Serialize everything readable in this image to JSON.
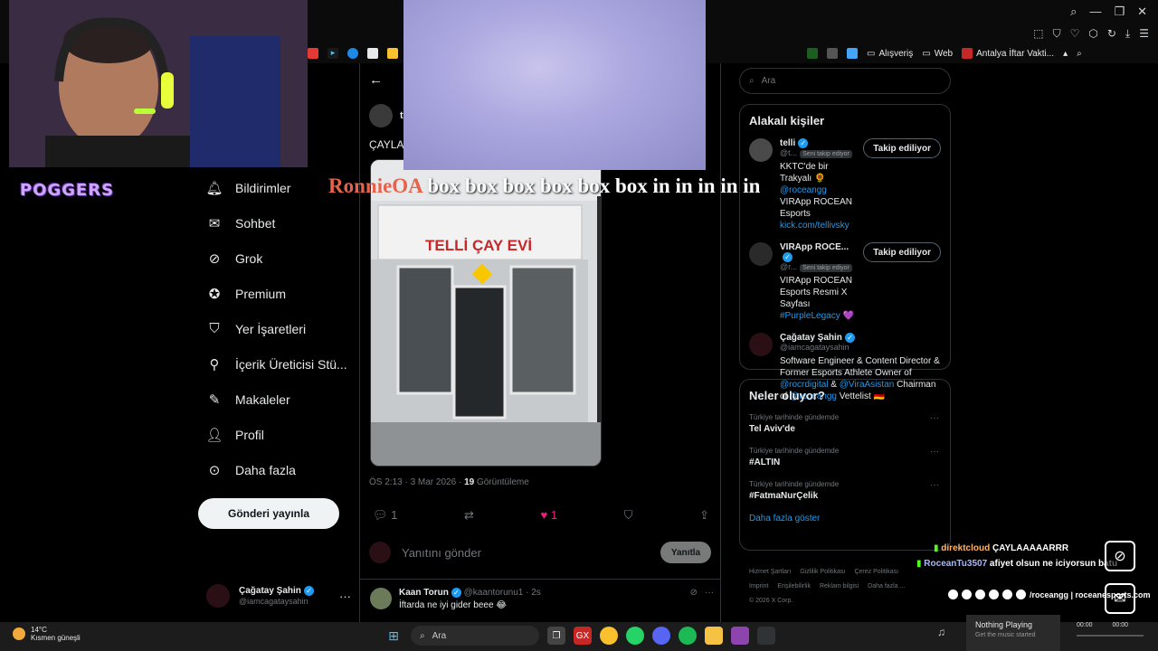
{
  "browser": {
    "bookmarks": [
      "Alışveriş",
      "Web",
      "Antalya İftar Vakti..."
    ]
  },
  "nav": {
    "items": [
      {
        "icon": "bell-icon",
        "label": "Bildirimler"
      },
      {
        "icon": "mail-icon",
        "label": "Sohbet"
      },
      {
        "icon": "grok-icon",
        "label": "Grok"
      },
      {
        "icon": "premium-icon",
        "label": "Premium"
      },
      {
        "icon": "bookmark-icon",
        "label": "Yer İşaretleri"
      },
      {
        "icon": "creator-icon",
        "label": "İçerik Üreticisi Stü..."
      },
      {
        "icon": "article-icon",
        "label": "Makaleler"
      },
      {
        "icon": "profile-icon",
        "label": "Profil"
      },
      {
        "icon": "more-icon",
        "label": "Daha fazla"
      }
    ],
    "post_button": "Gönderi yayınla",
    "account": {
      "name": "Çağatay Şahin",
      "handle": "@iamcagataysahin"
    }
  },
  "post": {
    "author_initial": "te",
    "text_prefix": "ÇAYLAA",
    "sign": {
      "line1": "TELLİ ÇAY EVİ"
    },
    "time": "ÖS 2:13 · 3 Mar 2026 · ",
    "views_count": "19",
    "views_label": " Görüntüleme",
    "replies": "1",
    "likes": "1",
    "reply_placeholder": "Yanıtını gönder",
    "reply_button": "Yanıtla"
  },
  "reply": {
    "name": "Kaan Torun",
    "handle": "@kaantorunu1 · 2s",
    "text": "İftarda ne iyi gider beee 😂"
  },
  "sidebar": {
    "search_placeholder": "Ara",
    "related_title": "Alakalı kişiler",
    "people": [
      {
        "name": "telli",
        "handle": "@t...",
        "tag": "Seni takip ediyor",
        "button": "Takip ediliyor",
        "bio_pre": "KKTC'de bir Trakyalı 🌻 ",
        "bio_link": "@roceangg",
        "bio_post": " VIRApp ROCEAN Esports",
        "bio_link2": "kick.com/tellivsky"
      },
      {
        "name": "VIRApp ROCE...",
        "handle": "@r...",
        "tag": "Seni takip ediyor",
        "button": "Takip ediliyor",
        "bio_pre": "VIRApp ROCEAN Esports Resmi X Sayfası ",
        "bio_link": "#PurpleLegacy",
        "bio_post": " 💜"
      },
      {
        "name": "Çağatay Şahin",
        "handle": "@iamcagataysahin",
        "bio_pre": "Software Engineer & Content Director & Former Esports Athlete Owner of ",
        "bio_link": "@rocrdigital",
        "bio_mid": " & ",
        "bio_link2": "@ViraAsistan",
        "bio_mid2": " Chairman of ",
        "bio_link3": "@roceangg",
        "bio_post": " Vettelist 🇩🇪"
      }
    ],
    "trends_title": "Neler oluyor?",
    "trends": [
      {
        "context": "Türkiye tarihinde gündemde",
        "topic": "Tel Aviv'de"
      },
      {
        "context": "Türkiye tarihinde gündemde",
        "topic": "#ALTIN"
      },
      {
        "context": "Türkiye tarihinde gündemde",
        "topic": "#FatmaNurÇelik"
      }
    ],
    "show_more": "Daha fazla göster",
    "footer": [
      "Hizmet Şartları",
      "Gizlilik Politikası",
      "Çerez Politikası",
      "Imprint",
      "Erişilebilirlik",
      "Reklam bilgisi",
      "Daha fazla ...",
      "© 2026 X Corp."
    ]
  },
  "stream": {
    "badge": "POGGERS",
    "message_name": "RonnieOA",
    "message_text": " box box box box box box in in in in in",
    "chat": [
      {
        "user": "direktcloud",
        "text": "ÇAYLAAAAARRR"
      },
      {
        "user": "RoceanTu3507",
        "text": "afiyet olsun ne iciyorsun batu"
      }
    ],
    "socials_text": "/roceangg | roceanesports.com"
  },
  "taskbar": {
    "weather_temp": "14°C",
    "weather_desc": "Kısmen güneşli",
    "search": "Ara",
    "music_title": "Nothing Playing",
    "music_sub": "Get the music started",
    "time_start": "00:00",
    "time_end": "00:00"
  }
}
